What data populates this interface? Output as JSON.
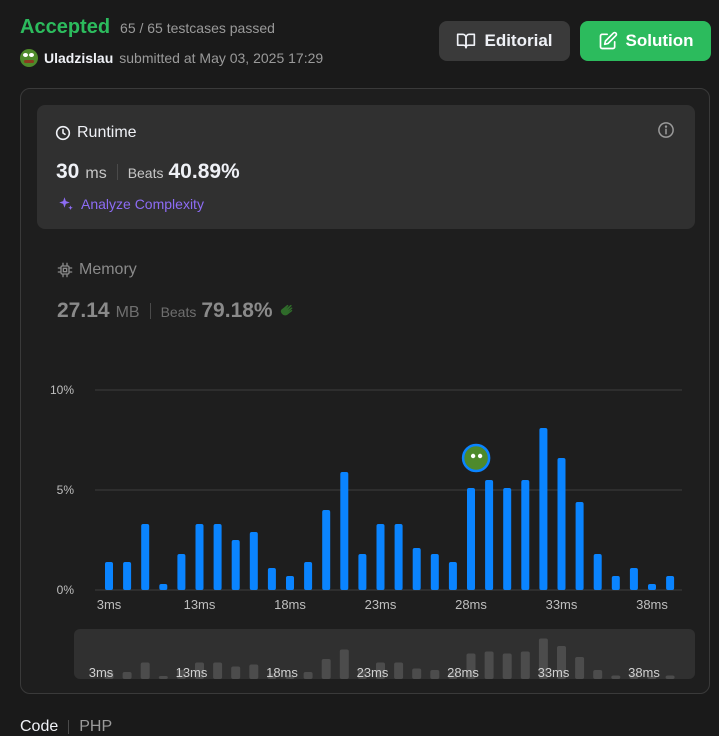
{
  "header": {
    "status": "Accepted",
    "testcases": "65 / 65 testcases passed",
    "username": "Uladzislau",
    "submitted_text": "submitted at May 03, 2025 17:29"
  },
  "buttons": {
    "editorial": "Editorial",
    "solution": "Solution"
  },
  "runtime": {
    "title": "Runtime",
    "value": "30",
    "unit": "ms",
    "beats_label": "Beats",
    "beats_value": "40.89%",
    "analyze": "Analyze Complexity"
  },
  "memory": {
    "title": "Memory",
    "value": "27.14",
    "unit": "MB",
    "beats_label": "Beats",
    "beats_value": "79.18%"
  },
  "footer": {
    "code_label": "Code",
    "language": "PHP"
  },
  "colors": {
    "accent_green": "#2cbb5d",
    "bar_blue": "#0a84ff",
    "analyze_purple": "#8d6cf5"
  },
  "chart_data": {
    "type": "bar",
    "ylim": [
      0,
      10
    ],
    "y_ticks": [
      "10%",
      "5%",
      "0%"
    ],
    "y_tick_values": [
      10,
      5,
      0
    ],
    "x_tick_labels": [
      "3ms",
      "13ms",
      "18ms",
      "23ms",
      "28ms",
      "33ms",
      "38ms"
    ],
    "x_tick_index": [
      0,
      5,
      10,
      15,
      20,
      25,
      30
    ],
    "values": [
      1.4,
      1.4,
      3.3,
      0.3,
      1.8,
      3.3,
      3.3,
      2.5,
      2.9,
      1.1,
      0.7,
      1.4,
      4.0,
      5.9,
      1.8,
      3.3,
      3.3,
      2.1,
      1.8,
      1.4,
      5.1,
      5.5,
      5.1,
      5.5,
      8.1,
      6.6,
      4.4,
      1.8,
      0.7,
      1.1,
      0.3,
      0.7
    ],
    "highlight_index": 21,
    "mini_x_tick_labels": [
      "3ms",
      "13ms",
      "18ms",
      "23ms",
      "28ms",
      "33ms",
      "38ms"
    ]
  }
}
